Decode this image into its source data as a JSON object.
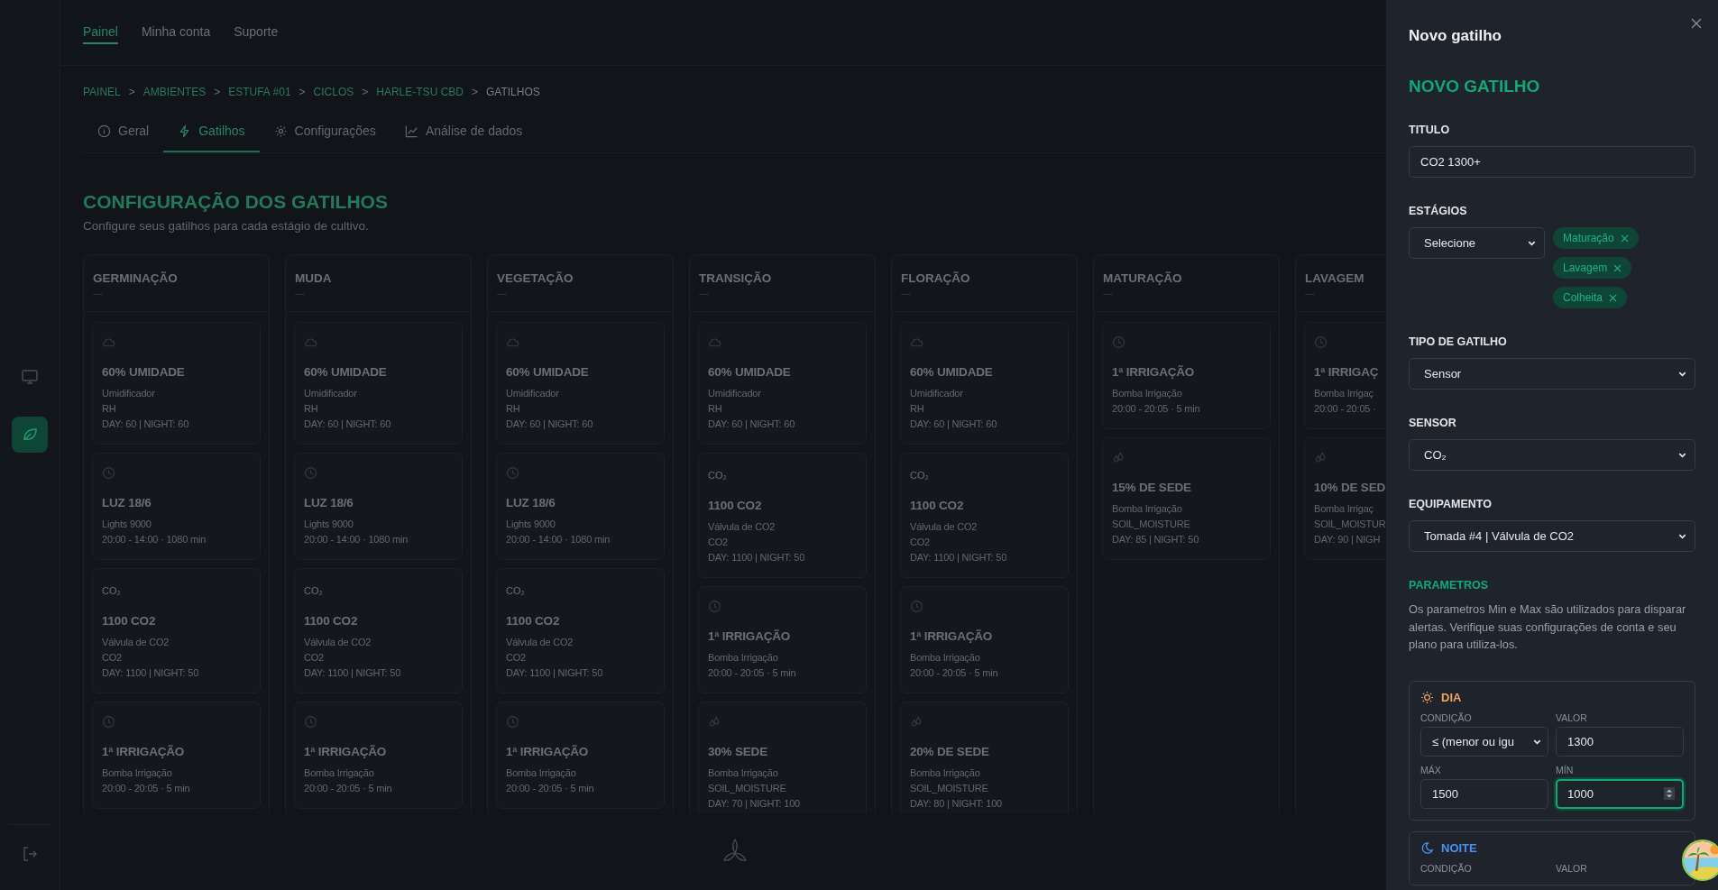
{
  "nav": [
    {
      "label": "Painel",
      "selected": true
    },
    {
      "label": "Minha conta",
      "selected": false
    },
    {
      "label": "Suporte",
      "selected": false
    }
  ],
  "breadcrumb": {
    "separator": ">",
    "items": [
      {
        "label": "PAINEL",
        "current": false
      },
      {
        "label": "AMBIENTES",
        "current": false
      },
      {
        "label": "ESTUFA #01",
        "current": false
      },
      {
        "label": "CICLOS",
        "current": false
      },
      {
        "label": "HARLE-TSU CBD",
        "current": false
      },
      {
        "label": "GATILHOS",
        "current": true
      }
    ]
  },
  "tabs": [
    {
      "label": "Geral",
      "kind": "info",
      "selected": false
    },
    {
      "label": "Gatilhos",
      "kind": "bolt",
      "selected": true
    },
    {
      "label": "Configurações",
      "kind": "gear",
      "selected": false
    },
    {
      "label": "Análise de dados",
      "kind": "chart",
      "selected": false
    }
  ],
  "page_title": "CONFIGURAÇÃO DOS GATILHOS",
  "page_subtitle": "Configure seus gatilhos para cada estágio de cultivo.",
  "stages": [
    {
      "title": "GERMINAÇÃO",
      "triggers": [
        {
          "kind": "cloud",
          "title": "60% UMIDADE",
          "lines": [
            "Umidificador",
            "RH",
            "DAY: 60 | NIGHT: 60"
          ]
        },
        {
          "kind": "clock",
          "title": "LUZ 18/6",
          "lines": [
            "Lights 9000",
            "20:00 - 14:00 · 1080 min"
          ]
        },
        {
          "kind": "co2",
          "icon_text": "CO₂",
          "title": "1100 CO2",
          "lines": [
            "Válvula de CO2",
            "CO2",
            "DAY: 1100 | NIGHT: 50"
          ]
        },
        {
          "kind": "clock",
          "title": "1ª IRRIGAÇÃO",
          "lines": [
            "Bomba Irrigação",
            "20:00 - 20:05 · 5 min"
          ]
        }
      ]
    },
    {
      "title": "MUDA",
      "triggers": [
        {
          "kind": "cloud",
          "title": "60% UMIDADE",
          "lines": [
            "Umidificador",
            "RH",
            "DAY: 60 | NIGHT: 60"
          ]
        },
        {
          "kind": "clock",
          "title": "LUZ 18/6",
          "lines": [
            "Lights 9000",
            "20:00 - 14:00 · 1080 min"
          ]
        },
        {
          "kind": "co2",
          "icon_text": "CO₂",
          "title": "1100 CO2",
          "lines": [
            "Válvula de CO2",
            "CO2",
            "DAY: 1100 | NIGHT: 50"
          ]
        },
        {
          "kind": "clock",
          "title": "1ª IRRIGAÇÃO",
          "lines": [
            "Bomba Irrigação",
            "20:00 - 20:05 · 5 min"
          ]
        }
      ]
    },
    {
      "title": "VEGETAÇÃO",
      "triggers": [
        {
          "kind": "cloud",
          "title": "60% UMIDADE",
          "lines": [
            "Umidificador",
            "RH",
            "DAY: 60 | NIGHT: 60"
          ]
        },
        {
          "kind": "clock",
          "title": "LUZ 18/6",
          "lines": [
            "Lights 9000",
            "20:00 - 14:00 · 1080 min"
          ]
        },
        {
          "kind": "co2",
          "icon_text": "CO₂",
          "title": "1100 CO2",
          "lines": [
            "Válvula de CO2",
            "CO2",
            "DAY: 1100 | NIGHT: 50"
          ]
        },
        {
          "kind": "clock",
          "title": "1ª IRRIGAÇÃO",
          "lines": [
            "Bomba Irrigação",
            "20:00 - 20:05 · 5 min"
          ]
        }
      ]
    },
    {
      "title": "TRANSIÇÃO",
      "triggers": [
        {
          "kind": "cloud",
          "title": "60% UMIDADE",
          "lines": [
            "Umidificador",
            "RH",
            "DAY: 60 | NIGHT: 60"
          ]
        },
        {
          "kind": "co2",
          "icon_text": "CO₂",
          "title": "1100 CO2",
          "lines": [
            "Válvula de CO2",
            "CO2",
            "DAY: 1100 | NIGHT: 50"
          ]
        },
        {
          "kind": "clock",
          "title": "1ª IRRIGAÇÃO",
          "lines": [
            "Bomba Irrigação",
            "20:00 - 20:05 · 5 min"
          ]
        },
        {
          "kind": "drops",
          "title": "30% SEDE",
          "lines": [
            "Bomba Irrigação",
            "SOIL_MOISTURE",
            "DAY: 70 | NIGHT: 100"
          ]
        }
      ]
    },
    {
      "title": "FLORAÇÃO",
      "triggers": [
        {
          "kind": "cloud",
          "title": "60% UMIDADE",
          "lines": [
            "Umidificador",
            "RH",
            "DAY: 60 | NIGHT: 60"
          ]
        },
        {
          "kind": "co2",
          "icon_text": "CO₂",
          "title": "1100 CO2",
          "lines": [
            "Válvula de CO2",
            "CO2",
            "DAY: 1100 | NIGHT: 50"
          ]
        },
        {
          "kind": "clock",
          "title": "1ª IRRIGAÇÃO",
          "lines": [
            "Bomba Irrigação",
            "20:00 - 20:05 · 5 min"
          ]
        },
        {
          "kind": "drops",
          "title": "20% DE SEDE",
          "lines": [
            "Bomba Irrigação",
            "SOIL_MOISTURE",
            "DAY: 80 | NIGHT: 100"
          ]
        }
      ]
    },
    {
      "title": "MATURAÇÃO",
      "triggers": [
        {
          "kind": "clock",
          "title": "1ª IRRIGAÇÃO",
          "lines": [
            "Bomba Irrigação",
            "20:00 - 20:05 · 5 min"
          ]
        },
        {
          "kind": "drops",
          "title": "15% DE SEDE",
          "lines": [
            "Bomba Irrigação",
            "SOIL_MOISTURE",
            "DAY: 85 | NIGHT: 50"
          ]
        }
      ]
    },
    {
      "title": "LAVAGEM",
      "triggers": [
        {
          "kind": "clock",
          "title": "1ª IRRIGAÇ",
          "lines": [
            "Bomba Irrigaç",
            "20:00 - 20:05 ·"
          ]
        },
        {
          "kind": "drops",
          "title": "10% DE SED",
          "lines": [
            "Bomba Irrigaç",
            "SOIL_MOISTUR",
            "DAY: 90 | NIGH"
          ]
        }
      ]
    }
  ],
  "panel": {
    "window_title": "Novo gatilho",
    "heading": "NOVO GATILHO",
    "titulo": {
      "label": "TITULO",
      "value": "CO2 1300+"
    },
    "estagios": {
      "label": "ESTÁGIOS",
      "value": "Selecione",
      "chips": [
        "Maturação",
        "Lavagem",
        "Colheita"
      ]
    },
    "selects": [
      {
        "label": "TIPO DE GATILHO",
        "value": "Sensor"
      },
      {
        "label": "SENSOR",
        "value": "CO₂"
      },
      {
        "label": "EQUIPAMENTO",
        "value": "Tomada #4 | Válvula de CO2"
      }
    ],
    "params_heading": "PARAMETROS",
    "params_text": "Os parametros Min e Max são utilizados para disparar alertas. Verifique suas configurações de conta e seu plano para utiliza-los.",
    "periods": [
      {
        "kind": "day",
        "label": "DIA",
        "fields": [
          {
            "kind": "select",
            "label": "CONDIÇÃO",
            "value": "≤ (menor ou igu",
            "focused": false
          },
          {
            "kind": "number",
            "label": "VALOR",
            "value": "1300",
            "focused": false
          },
          {
            "kind": "number",
            "label": "MÁX",
            "value": "1500",
            "focused": false
          },
          {
            "kind": "number",
            "label": "MÍN",
            "value": "1000",
            "focused": true
          }
        ]
      },
      {
        "kind": "night",
        "label": "NOITE",
        "fields": [
          {
            "kind": "label",
            "label": "CONDIÇÃO"
          },
          {
            "kind": "label",
            "label": "VALOR"
          }
        ]
      }
    ]
  }
}
